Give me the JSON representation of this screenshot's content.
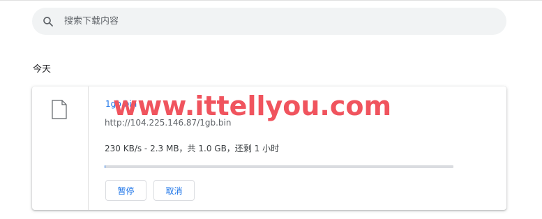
{
  "search": {
    "placeholder": "搜索下载内容",
    "value": ""
  },
  "section": {
    "heading": "今天"
  },
  "download": {
    "file_name": "1gb.bin",
    "url": "http://104.225.146.87/1gb.bin",
    "status": "230 KB/s - 2.3 MB，共 1.0 GB，还剩 1 小时",
    "progress_fraction": 0.0023,
    "pause_label": "暂停",
    "cancel_label": "取消"
  },
  "watermark": {
    "text": "www.ittellyou.com"
  },
  "icons": {
    "search": "search-icon",
    "file": "file-icon"
  },
  "colors": {
    "accent": "#1a73e8",
    "watermark": "#f0545e",
    "track": "#dadce0"
  }
}
